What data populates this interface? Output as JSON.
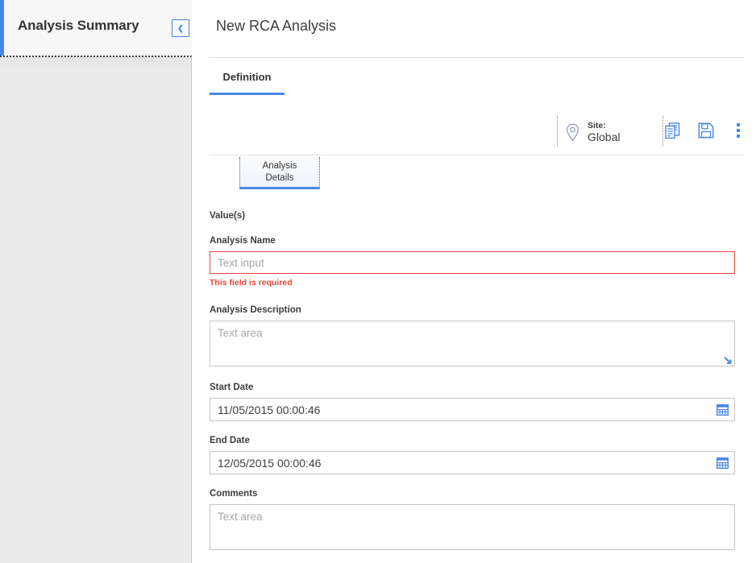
{
  "left_panel": {
    "title": "Analysis Summary",
    "collapse_icon": "chevron-left-icon",
    "collapse_glyph": "❮"
  },
  "main": {
    "title": "New RCA Analysis",
    "tabs": [
      {
        "label": "Definition",
        "active": true
      }
    ],
    "toolbar": {
      "site_icon": "location-pin-icon",
      "site_label": "Site:",
      "site_value": "Global",
      "copy_icon": "copy-documents-icon",
      "save_icon": "save-floppy-icon",
      "more_icon": "more-vertical-icon"
    },
    "subtabs": [
      {
        "label": "Analysis\nDetails",
        "line1": "Analysis",
        "line2": "Details",
        "active": true
      }
    ],
    "form": {
      "section_header": "Value(s)",
      "fields": [
        {
          "label": "Analysis Name",
          "type": "text",
          "value": "",
          "placeholder": "Text input",
          "error": "This field is required"
        },
        {
          "label": "Analysis Description",
          "type": "textarea",
          "value": "",
          "placeholder": "Text area"
        },
        {
          "label": "Start Date",
          "type": "date",
          "value": "11/05/2015 00:00:46",
          "icon": "calendar-icon"
        },
        {
          "label": "End Date",
          "type": "date",
          "value": "12/05/2015 00:00:46",
          "icon": "calendar-icon"
        },
        {
          "label": "Comments",
          "type": "textarea",
          "value": "",
          "placeholder": "Text area"
        }
      ]
    }
  },
  "colors": {
    "accent_blue": "#4a86e8",
    "error_red": "#e8483a",
    "text_dark": "#3c3c3c",
    "panel_gray": "#ebebeb",
    "border_gray": "#c6c6c6"
  }
}
